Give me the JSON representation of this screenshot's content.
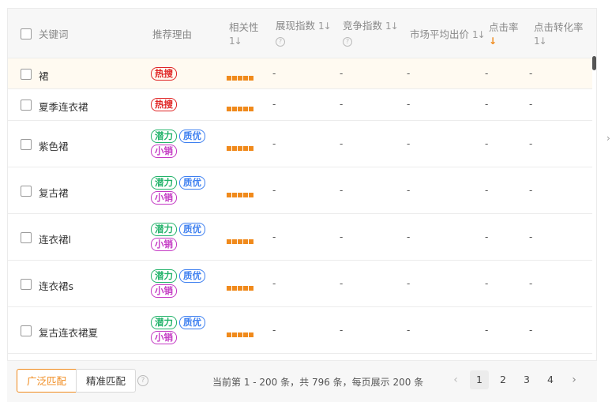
{
  "headers": {
    "keyword": "关键词",
    "reason": "推荐理由",
    "relevance": "相关性",
    "impression": "展现指数",
    "competition": "竞争指数",
    "avg_bid": "市场平均出价",
    "ctr": "点击率",
    "cvr": "点击转化率",
    "sort_icon": "1↓",
    "help_icon": "?",
    "ctr_sort_active": "↓"
  },
  "rows": [
    {
      "keyword": "裙",
      "tags": [
        "热搜"
      ],
      "relevance": 5,
      "impression": "-",
      "competition": "-",
      "avg_bid": "-",
      "ctr": "-",
      "cvr": "-"
    },
    {
      "keyword": "夏季连衣裙",
      "tags": [
        "热搜"
      ],
      "relevance": 5,
      "impression": "-",
      "competition": "-",
      "avg_bid": "-",
      "ctr": "-",
      "cvr": "-"
    },
    {
      "keyword": "紫色裙",
      "tags": [
        "潜力",
        "质优",
        "小销"
      ],
      "relevance": 5,
      "impression": "-",
      "competition": "-",
      "avg_bid": "-",
      "ctr": "-",
      "cvr": "-"
    },
    {
      "keyword": "复古裙",
      "tags": [
        "潜力",
        "质优",
        "小销"
      ],
      "relevance": 5,
      "impression": "-",
      "competition": "-",
      "avg_bid": "-",
      "ctr": "-",
      "cvr": "-"
    },
    {
      "keyword": "连衣裙l",
      "tags": [
        "潜力",
        "质优",
        "小销"
      ],
      "relevance": 5,
      "impression": "-",
      "competition": "-",
      "avg_bid": "-",
      "ctr": "-",
      "cvr": "-"
    },
    {
      "keyword": "连衣裙s",
      "tags": [
        "潜力",
        "质优",
        "小销"
      ],
      "relevance": 5,
      "impression": "-",
      "competition": "-",
      "avg_bid": "-",
      "ctr": "-",
      "cvr": "-"
    },
    {
      "keyword": "复古连衣裙夏",
      "tags": [
        "潜力",
        "质优",
        "小销"
      ],
      "relevance": 5,
      "impression": "-",
      "competition": "-",
      "avg_bid": "-",
      "ctr": "-",
      "cvr": "-"
    }
  ],
  "footer": {
    "broad_match": "广泛匹配",
    "exact_match": "精准匹配",
    "help_icon": "?",
    "page_info": "当前第 1 - 200 条，共 796 条，每页展示 200 条",
    "pages": [
      "1",
      "2",
      "3",
      "4"
    ],
    "current_page": "1",
    "prev": "‹",
    "next": "›"
  },
  "side_chevron": "›",
  "colors": {
    "accent": "#f08a1c",
    "tag_hot": "#e02525",
    "tag_potential": "#24b36b",
    "tag_quality": "#3d7ff0",
    "tag_small": "#c43ac4",
    "highlight_row": "#fffaf1"
  }
}
